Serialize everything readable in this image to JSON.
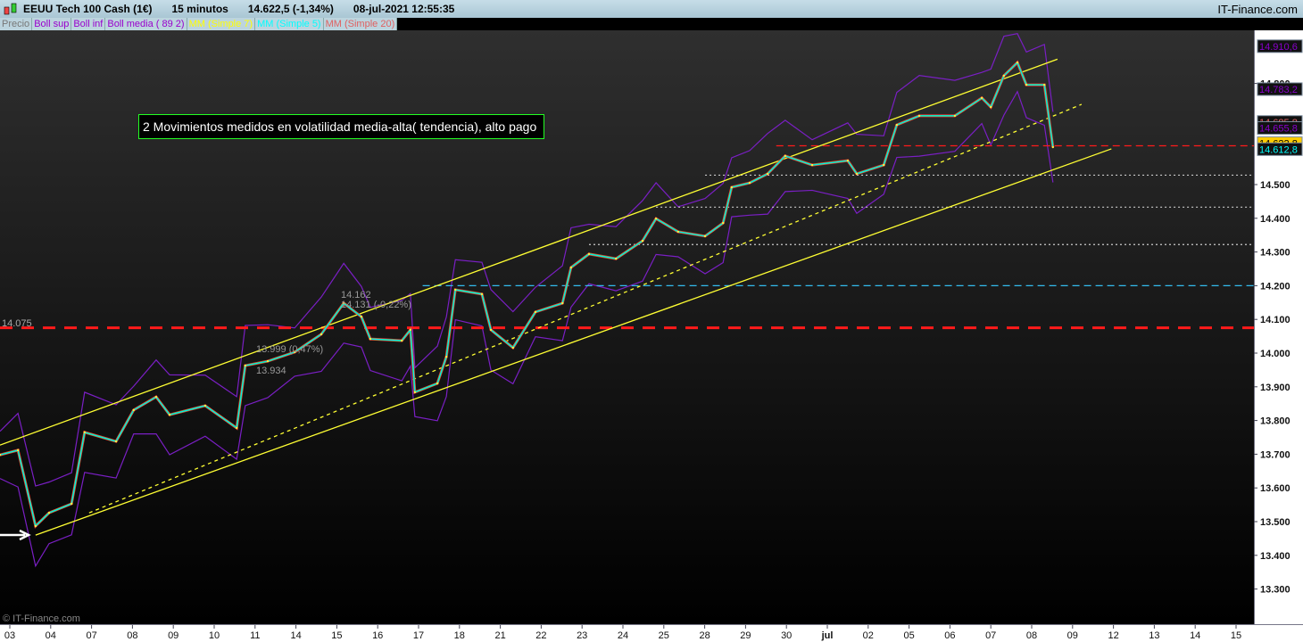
{
  "titlebar": {
    "instrument": "EEUU Tech 100 Cash (1€)",
    "timeframe": "15 minutos",
    "price": "14.622,5 (-1,34%)",
    "datetime": "08-jul-2021 12:55:35",
    "brand": "IT-Finance.com"
  },
  "legend": [
    {
      "label": "Precio",
      "color": "#777777"
    },
    {
      "label": "Boll sup",
      "color": "#9900cc"
    },
    {
      "label": "Boll inf",
      "color": "#9900cc"
    },
    {
      "label": "Boll media ( 89 2)",
      "color": "#9900cc"
    },
    {
      "label": "MM (Simple 7)",
      "color": "#ffff00"
    },
    {
      "label": "MM (Simple 5)",
      "color": "#00ffff"
    },
    {
      "label": "MM (Simple 20)",
      "color": "#e06060"
    }
  ],
  "note": "2 Movimientos medidos en volatilidad media-alta( tendencia), alto pago",
  "copyright": "© IT-Finance.com",
  "left_level_label": "14.075",
  "annotations": [
    "14.162",
    "14.131 (-0,22%)",
    "13.999 (0,47%)",
    "13.934"
  ],
  "chart_data": {
    "type": "line",
    "title": "EEUU Tech 100 Cash (1€) 15 minutos",
    "xlabel": "",
    "ylabel": "",
    "ylim": [
      13.22,
      14.98
    ],
    "x_ticks": [
      "03",
      "04",
      "07",
      "08",
      "09",
      "10",
      "11",
      "14",
      "15",
      "16",
      "17",
      "18",
      "21",
      "22",
      "23",
      "24",
      "25",
      "28",
      "29",
      "30",
      "jul",
      "02",
      "05",
      "06",
      "07",
      "08",
      "09",
      "12",
      "13",
      "14",
      "15"
    ],
    "y_ticks": [
      "13.300",
      "13.400",
      "13.500",
      "13.600",
      "13.700",
      "13.800",
      "13.900",
      "14.000",
      "14.100",
      "14.200",
      "14.300",
      "14.400",
      "14.500",
      "14.800"
    ],
    "y_tick_values": [
      13.3,
      13.4,
      13.5,
      13.6,
      13.7,
      13.8,
      13.9,
      14.0,
      14.1,
      14.2,
      14.3,
      14.4,
      14.5,
      14.8
    ],
    "series": [
      {
        "name": "Precio",
        "points": [
          [
            -0.24,
            13.698
          ],
          [
            0.2,
            13.712
          ],
          [
            0.63,
            13.487
          ],
          [
            0.96,
            13.526
          ],
          [
            1.51,
            13.553
          ],
          [
            1.83,
            13.765
          ],
          [
            2.6,
            13.738
          ],
          [
            3.03,
            13.831
          ],
          [
            3.58,
            13.87
          ],
          [
            3.91,
            13.817
          ],
          [
            4.78,
            13.844
          ],
          [
            5.55,
            13.778
          ],
          [
            5.76,
            13.963
          ],
          [
            6.31,
            13.976
          ],
          [
            6.97,
            14.003
          ],
          [
            7.62,
            14.056
          ],
          [
            8.17,
            14.148
          ],
          [
            8.6,
            14.108
          ],
          [
            8.82,
            14.042
          ],
          [
            9.59,
            14.037
          ],
          [
            9.8,
            14.069
          ],
          [
            9.91,
            13.884
          ],
          [
            10.46,
            13.91
          ],
          [
            10.68,
            13.989
          ],
          [
            10.9,
            14.188
          ],
          [
            11.55,
            14.175
          ],
          [
            11.77,
            14.069
          ],
          [
            12.31,
            14.016
          ],
          [
            12.86,
            14.122
          ],
          [
            13.52,
            14.148
          ],
          [
            13.73,
            14.254
          ],
          [
            14.17,
            14.294
          ],
          [
            14.83,
            14.28
          ],
          [
            15.48,
            14.333
          ],
          [
            15.81,
            14.399
          ],
          [
            16.35,
            14.36
          ],
          [
            17.01,
            14.347
          ],
          [
            17.45,
            14.386
          ],
          [
            17.66,
            14.492
          ],
          [
            18.1,
            14.505
          ],
          [
            18.54,
            14.532
          ],
          [
            18.97,
            14.585
          ],
          [
            19.63,
            14.558
          ],
          [
            20.5,
            14.571
          ],
          [
            20.72,
            14.532
          ],
          [
            21.38,
            14.558
          ],
          [
            21.7,
            14.677
          ],
          [
            22.25,
            14.704
          ],
          [
            23.12,
            14.704
          ],
          [
            23.78,
            14.757
          ],
          [
            24.0,
            14.73
          ],
          [
            24.32,
            14.823
          ],
          [
            24.65,
            14.862
          ],
          [
            24.87,
            14.796
          ],
          [
            25.31,
            14.796
          ],
          [
            25.52,
            14.611
          ]
        ]
      }
    ],
    "trendlines": [
      {
        "name": "channel-upper",
        "color": "#ffff33",
        "dash": false,
        "from": [
          -0.24,
          13.727
        ],
        "to": [
          25.63,
          14.872
        ]
      },
      {
        "name": "channel-lower",
        "color": "#ffff33",
        "dash": false,
        "from": [
          0.63,
          13.46
        ],
        "to": [
          26.95,
          14.606
        ]
      },
      {
        "name": "channel-middle",
        "color": "#ffff33",
        "dash": true,
        "from": [
          1.94,
          13.526
        ],
        "to": [
          26.22,
          14.738
        ]
      }
    ],
    "hlines": [
      {
        "name": "support-14075",
        "price": 14.075,
        "color": "#ff1a1a",
        "from": -0.3,
        "style": "thick-dash"
      },
      {
        "name": "level-14200",
        "price": 14.2,
        "color": "#33bbee",
        "from": 10.1,
        "style": "dash"
      },
      {
        "name": "level-14322",
        "price": 14.322,
        "color": "#cccccc",
        "from": 14.17,
        "style": "dot"
      },
      {
        "name": "level-14433",
        "price": 14.433,
        "color": "#cccccc",
        "from": 15.81,
        "style": "dot"
      },
      {
        "name": "level-14528",
        "price": 14.528,
        "color": "#cccccc",
        "from": 17.01,
        "style": "dot"
      },
      {
        "name": "level-14615",
        "price": 14.615,
        "color": "#ff1a1a",
        "from": 18.75,
        "style": "dash"
      }
    ],
    "price_tags": [
      {
        "value": "14.910,6",
        "price": 14.9106,
        "color": "#8800cc",
        "bg": "#111111"
      },
      {
        "value": "14.783,2",
        "price": 14.7832,
        "color": "#8800cc",
        "bg": "#111111"
      },
      {
        "value": "14.685,8",
        "price": 14.6858,
        "color": "#e06060",
        "bg": "#111111"
      },
      {
        "value": "14.655,8",
        "price": 14.6558,
        "color": "#8800cc",
        "bg": "#111111"
      },
      {
        "value": "14.622,8",
        "price": 14.6228,
        "color": "#000000",
        "bg": "#ffcc00"
      },
      {
        "value": "14.612,8",
        "price": 14.6128,
        "color": "#00ffff",
        "bg": "#111111"
      }
    ]
  }
}
